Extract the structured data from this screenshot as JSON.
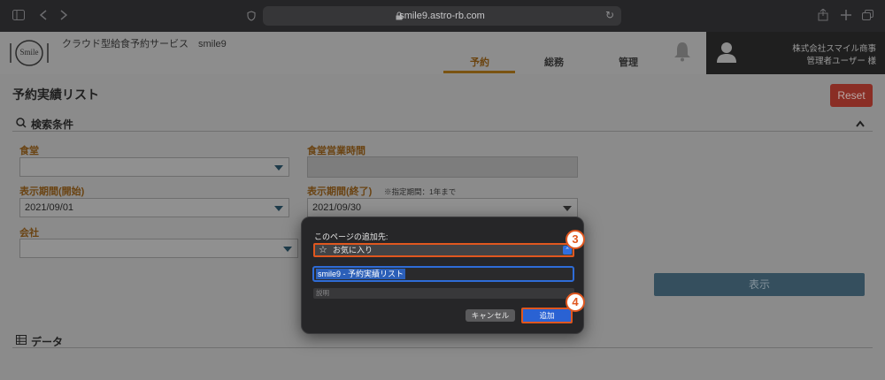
{
  "browser": {
    "url": "smile9.astro-rb.com",
    "icons": [
      "sidebar-icon",
      "back-icon",
      "forward-icon",
      "privacy-shield-icon",
      "lock-icon",
      "reload-icon",
      "share-icon",
      "new-tab-icon",
      "tabs-overview-icon"
    ]
  },
  "header": {
    "logo_text": "Smile",
    "app_title": "クラウド型給食予約サービス　smile9",
    "nav": [
      {
        "label": "予約",
        "active": true
      },
      {
        "label": "総務",
        "active": false
      },
      {
        "label": "管理",
        "active": false
      }
    ],
    "user": {
      "company": "株式会社スマイル商事",
      "name": "管理者ユーザー 様"
    }
  },
  "page": {
    "title": "予約実績リスト",
    "reset_label": "Reset",
    "search_section": "検索条件",
    "data_section": "データ",
    "fields": {
      "cafeteria_label": "食堂",
      "cafeteria_value": "",
      "hours_label": "食堂営業時間",
      "start_label": "表示期間(開始)",
      "start_value": "2021/09/01",
      "end_label": "表示期間(終了)",
      "end_note": "※指定期間：1年まで",
      "end_value": "2021/09/30",
      "company_label": "会社",
      "company_value": ""
    },
    "show_label": "表示"
  },
  "dialog": {
    "title": "このページの追加先:",
    "location": "お気に入り",
    "name_value": "smile9 - 予約実績リスト",
    "description_placeholder": "説明",
    "cancel_label": "キャンセル",
    "add_label": "追加"
  },
  "annotations": {
    "step3": "3",
    "step4": "4"
  },
  "colors": {
    "highlight": "#e0571f",
    "accent_blue": "#2a62d3",
    "reset_red": "#8a2e25",
    "show_button": "#354f5e"
  }
}
